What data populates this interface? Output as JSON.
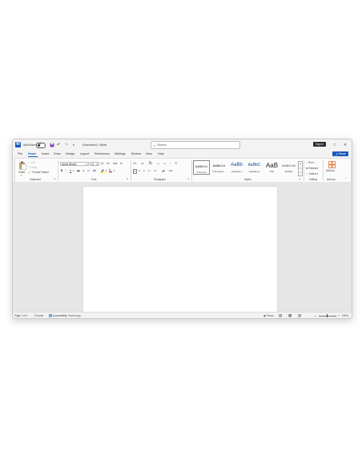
{
  "titlebar": {
    "app_letter": "W",
    "autosave_label": "AutoSave",
    "autosave_state": "Off",
    "doc_title": "Document1 • Word",
    "search_placeholder": "Search",
    "signin_label": "Sign in",
    "minimize": "—",
    "maximize": "□",
    "close": "✕",
    "save_icon": "save-icon",
    "undo_icon": "undo-icon",
    "redo_icon": "redo-icon"
  },
  "menu": {
    "items": [
      "File",
      "Home",
      "Insert",
      "Draw",
      "Design",
      "Layout",
      "References",
      "Mailings",
      "Review",
      "View",
      "Help"
    ],
    "active": "Home",
    "share_label": "Share"
  },
  "ribbon": {
    "clipboard": {
      "paste": "Paste",
      "cut": "Cut",
      "copy": "Copy",
      "format_painter": "Format Painter",
      "label": "Clipboard"
    },
    "font": {
      "family": "Aptos (Body)",
      "size": "11",
      "label": "Font"
    },
    "paragraph": {
      "label": "Paragraph"
    },
    "styles": {
      "items": [
        {
          "sample": "AaBbCcI",
          "name": "¶ Normal"
        },
        {
          "sample": "AaBbCcI",
          "name": "¶ No Spac..."
        },
        {
          "sample": "AaBb",
          "name": "Heading 1"
        },
        {
          "sample": "AaBbC",
          "name": "Heading 2"
        },
        {
          "sample": "AaB",
          "name": "Title"
        },
        {
          "sample": "AaBbCcĐ",
          "name": "Subtitle"
        }
      ],
      "label": "Styles"
    },
    "editing": {
      "find": "Find",
      "replace": "Replace",
      "select": "Select",
      "label": "Editing"
    },
    "addins": {
      "button": "Add-ins",
      "label": "Add-ins"
    }
  },
  "status": {
    "page": "Page 1 of 1",
    "words": "0 words",
    "accessibility": "Accessibility: Good to go",
    "focus": "Focus",
    "zoom": "100%"
  },
  "colors": {
    "accent": "#185abd",
    "highlight": "#ffe000",
    "font_color": "#d40000"
  }
}
